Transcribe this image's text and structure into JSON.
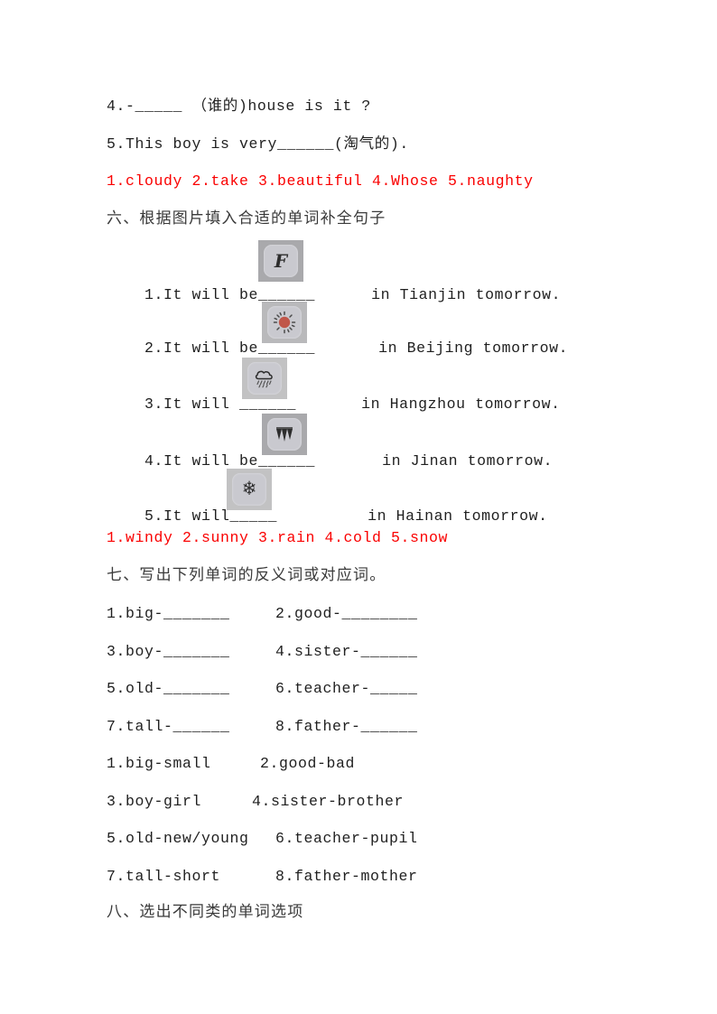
{
  "document": {
    "language": "zh-CN + English",
    "page_background": "#ffffff",
    "answer_color": "#fa0000",
    "text_color": "#1f1f1f"
  },
  "section_five_tail": {
    "items": [
      "4.-_____ （谁的)house is it ?",
      "5.This boy is very______(淘气的)."
    ],
    "answers": "1.cloudy 2.take 3.beautiful 4.Whose 5.naughty"
  },
  "section_six": {
    "heading": "六、根据图片填入合适的单词补全句子",
    "questions": [
      {
        "number": "1.",
        "before": "It will be______",
        "after": "in Tianjin tomorrow.",
        "icon": "wind-icon"
      },
      {
        "number": "2.",
        "before": "It will be______",
        "after": "in Beijing tomorrow.",
        "icon": "sun-icon"
      },
      {
        "number": "3.",
        "before": "It will ______",
        "after": "in Hangzhou tomorrow.",
        "icon": "rain-cloud-icon"
      },
      {
        "number": "4.",
        "before": "It will be______",
        "after": "in Jinan tomorrow.",
        "icon": "cold-icicle-icon"
      },
      {
        "number": "5.",
        "before": "It will_____",
        "after": "in Hainan tomorrow.",
        "icon": "snowflake-icon"
      }
    ],
    "answers": "1.windy 2.sunny 3.rain 4.cold 5.snow"
  },
  "section_seven": {
    "heading": "七、写出下列单词的反义词或对应词。",
    "blanks": [
      {
        "left": "1.big-_______",
        "right": "2.good-________"
      },
      {
        "left": "3.boy-_______",
        "right": "4.sister-______"
      },
      {
        "left": "5.old-_______",
        "right": "6.teacher-_____"
      },
      {
        "left": "7.tall-______",
        "right": "8.father-______"
      }
    ],
    "answers": [
      {
        "left": "1.big-small",
        "right": "2.good-bad"
      },
      {
        "left": "3.boy-girl",
        "right": "4.sister-brother"
      },
      {
        "left": "5.old-new/young",
        "right": "6.teacher-pupil"
      },
      {
        "left": "7.tall-short",
        "right": "8.father-mother"
      }
    ]
  },
  "section_eight": {
    "heading": "八、选出不同类的单词选项"
  }
}
